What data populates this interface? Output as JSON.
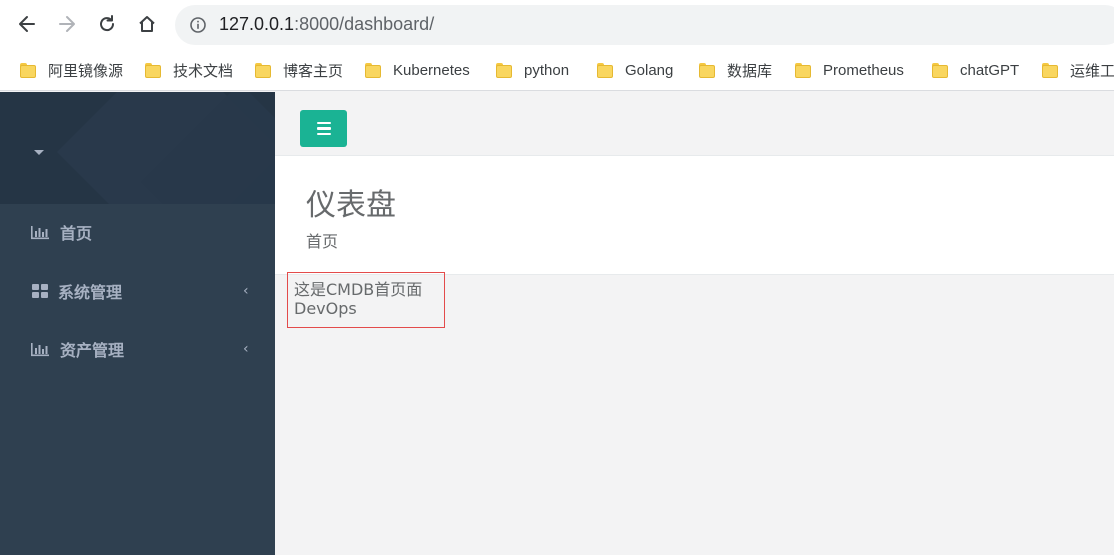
{
  "browser": {
    "url_host": "127.0.0.1",
    "url_path": ":8000/dashboard/",
    "bookmarks": [
      "阿里镜像源",
      "技术文档",
      "博客主页",
      "Kubernetes",
      "python",
      "Golang",
      "数据库",
      "Prometheus",
      "chatGPT",
      "运维工"
    ]
  },
  "sidebar": {
    "items": [
      {
        "label": "首页",
        "icon": "bar-chart-icon",
        "has_arrow": false
      },
      {
        "label": "系统管理",
        "icon": "grid-icon",
        "has_arrow": true
      },
      {
        "label": "资产管理",
        "icon": "bar-chart-icon",
        "has_arrow": true
      }
    ],
    "arrow_glyph": "‹"
  },
  "header": {
    "title": "仪表盘",
    "breadcrumb": "首页"
  },
  "content": {
    "line1": "这是CMDB首页面",
    "line2": "DevOps"
  },
  "colors": {
    "sidebar_bg": "#2f4050",
    "accent": "#1ab394",
    "highlight_border": "#e34b4b"
  }
}
